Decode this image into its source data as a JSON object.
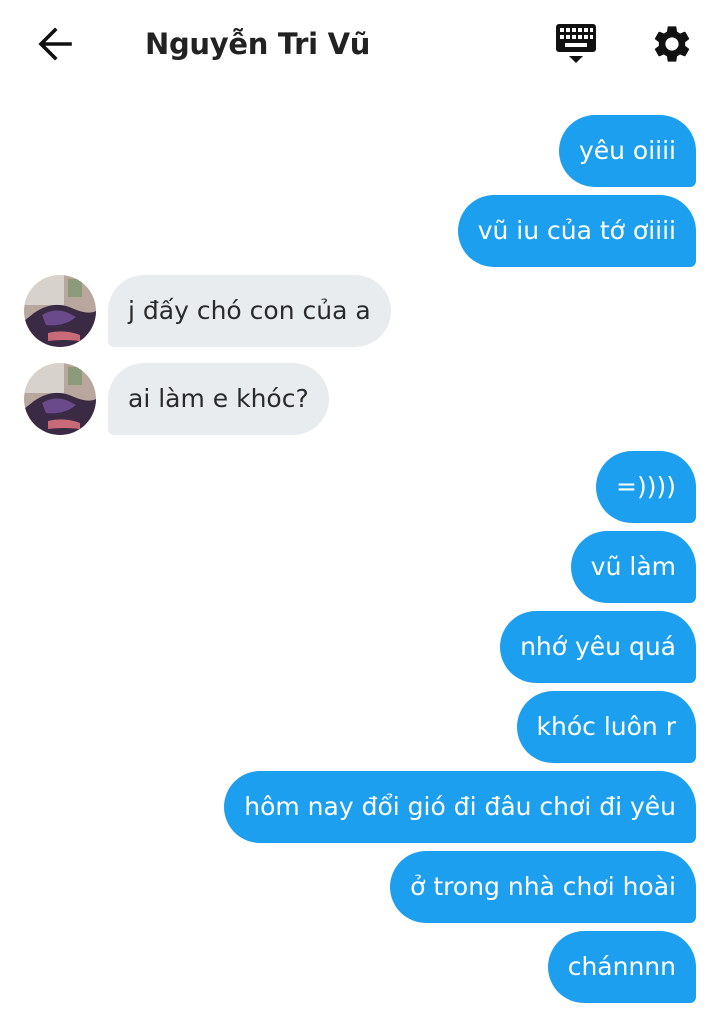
{
  "header": {
    "title": "Nguyễn Tri Vũ",
    "back_icon": "arrow-left-icon",
    "keyboard_icon": "keyboard-icon",
    "settings_icon": "gear-icon"
  },
  "colors": {
    "outgoing_bubble": "#1d9ff0",
    "incoming_bubble": "#e9ecef"
  },
  "messages": [
    {
      "sender": "me",
      "text": "yêu oiiii"
    },
    {
      "sender": "me",
      "text": "vũ iu của tớ ơiiii"
    },
    {
      "sender": "contact",
      "text": "j đấy chó con của a"
    },
    {
      "sender": "contact",
      "text": "ai làm e khóc?"
    },
    {
      "sender": "me",
      "text": "=))))"
    },
    {
      "sender": "me",
      "text": "vũ làm"
    },
    {
      "sender": "me",
      "text": "nhớ yêu quá"
    },
    {
      "sender": "me",
      "text": "khóc luôn r"
    },
    {
      "sender": "me",
      "text": "hôm nay đổi gió đi đâu chơi đi yêu"
    },
    {
      "sender": "me",
      "text": "ở trong nhà chơi hoài"
    },
    {
      "sender": "me",
      "text": "chánnnn"
    }
  ]
}
